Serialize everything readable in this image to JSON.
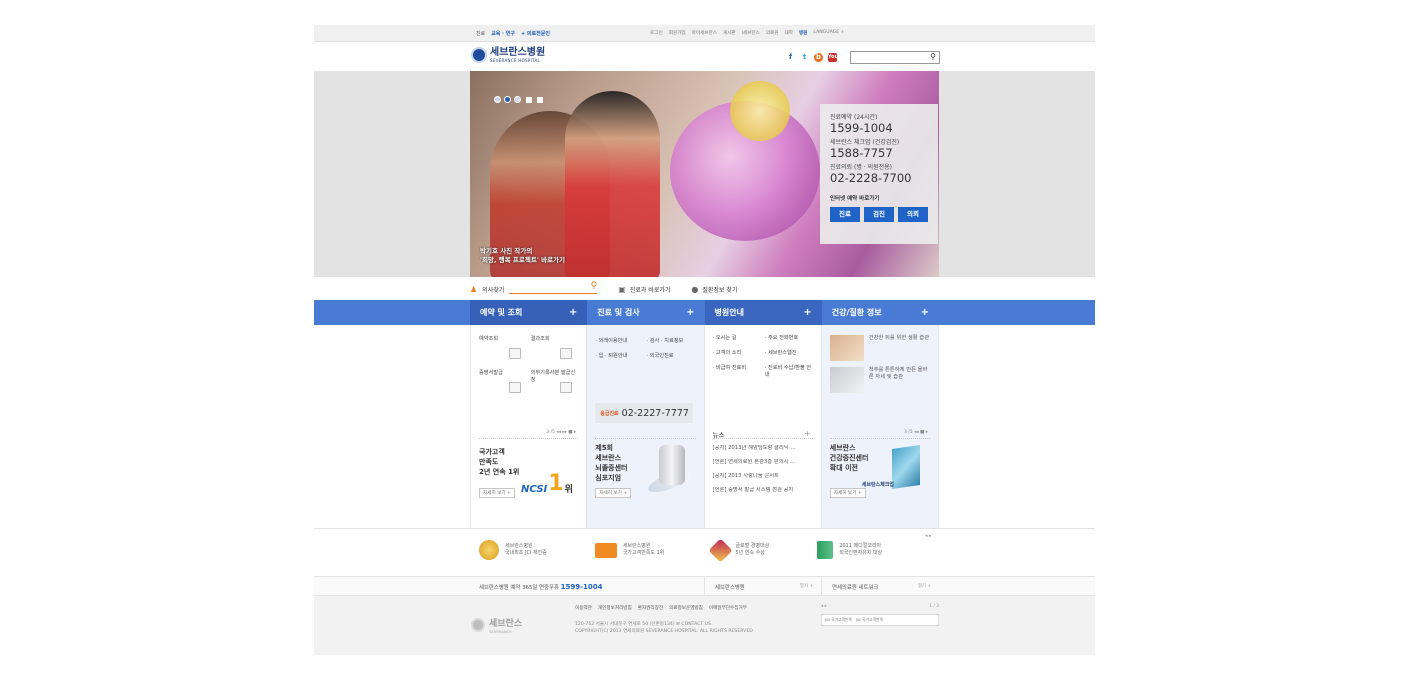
{
  "util": {
    "left": [
      "진료",
      "교육 · 연구",
      "+ 의료전문인"
    ],
    "right": [
      "로그인",
      "회원가입",
      "마이세브란스",
      "게시판",
      "l세브란스",
      "의료원",
      "대학",
      "병원",
      "LANGUAGE +"
    ]
  },
  "header": {
    "logo_ko": "세브란스병원",
    "logo_en": "SEVERANCE HOSPITAL",
    "sns": [
      "f",
      "t",
      "b",
      "You"
    ],
    "search_placeholder": ""
  },
  "hero": {
    "caption_line1": "박기호 사진 작가의",
    "caption_line2": "'희망, 행복 프로젝트' 바로가기",
    "info": {
      "label1": "진료예약 (24시간)",
      "tel1": "1599-1004",
      "label2": "세브란스 체크업 (건강검진)",
      "tel2": "1588-7757",
      "label3": "진료의뢰 (병 · 의원전용)",
      "tel3": "02-2228-7700",
      "go_label": "인터넷 예약 바로가기",
      "btn1": "진료",
      "btn2": "검진",
      "btn3": "의뢰"
    }
  },
  "quick": {
    "doctor": "의사찾기",
    "dept": "진료과 바로가기",
    "disease": "질환정보 찾기"
  },
  "nav": {
    "tab1": "예약 및 조회",
    "tab2": "진료 및 검사",
    "tab3": "병원안내",
    "tab4": "건강/질환 정보",
    "plus": "+"
  },
  "panel1": {
    "items": [
      "예약조회",
      "결과조회",
      "증명서발급",
      "의무기록사본 발급신청"
    ],
    "pager": "3 /5",
    "promo1": "국가고객",
    "promo2": "만족도",
    "promo3": "2년 연속 1위",
    "ncsi": "NCSI",
    "one": "1",
    "wi": "위",
    "more": "자세히 보기 +"
  },
  "panel2": {
    "items": [
      "외래이용안내",
      "검사 · 치료정보",
      "입 · 퇴원안내",
      "외국인진료"
    ],
    "emerg_label": "응급진료",
    "emerg_tel": "02-2227-7777",
    "promo1": "제5회",
    "promo2": "세브란스",
    "promo3": "뇌졸중센터",
    "promo4": "심포지엄",
    "more": "자세히 보기 +"
  },
  "panel3": {
    "items": [
      "오시는 길",
      "주요 전화번호",
      "고객의 소리",
      "세브란스웹진",
      "비급여 진료비",
      "진료비 수납/환불 안내"
    ],
    "news_title": "뉴스",
    "news_plus": "+",
    "news": [
      "[공지] 2013년 해양딩도랑 클리닉 ...",
      "[언론] 연세의료원 본관3층 편의시 ...",
      "[공지] 2013 사랑나눔 콘서트",
      "[언론] 증명서 발급 시스템 점검 공지"
    ]
  },
  "panel4": {
    "tip1": "건강한 뒤를 위한 생활 습관",
    "tip2": "척추를 튼튼하게 만든 올바른 자세 및 습관",
    "pager": "3 /5",
    "promo1": "세브란스",
    "promo2": "건강증진센터",
    "promo3": "확대 이전",
    "checkup": "세브란스체크업",
    "more": "자세히 보기 +"
  },
  "awards": [
    {
      "l1": "세브란스병원",
      "l2": "국내최초 JCI 재인증"
    },
    {
      "l1": "세브란스병원",
      "l2": "국가고객만족도 1위"
    },
    {
      "l1": "글로벌 경영대상",
      "l2": "5년 연속 수상"
    },
    {
      "l1": "2011 메디컬코리아",
      "l2": "외국인환자유치 대상"
    }
  ],
  "info_row": {
    "reserve_text": "세브란스병원 예약 365일 연중무휴",
    "reserve_tel": "1599-1004",
    "c2": "세브란스병원",
    "c3": "연세의료원 네트워크",
    "more": "열기 +"
  },
  "footer": {
    "logo_ko": "세브란스",
    "logo_en": "SEVERANCE",
    "links": [
      "이용약관",
      "개인정보처리방침",
      "환자권리장전",
      "의료정보운영방침",
      "이메일무단수집거부"
    ],
    "addr1": "120-752 서울시 서대문구 연세로 50 (신촌동134)   ✉ CONTACT US",
    "addr2": "COPYRIGHT(C) 2013 연세의료원 SEVERANCE HOSPITAL. ALL RIGHTS RESERVED",
    "banner_page": "1 / 3",
    "banner1": "JW 국가고객만족",
    "banner2": "JW 국가고객만족"
  }
}
